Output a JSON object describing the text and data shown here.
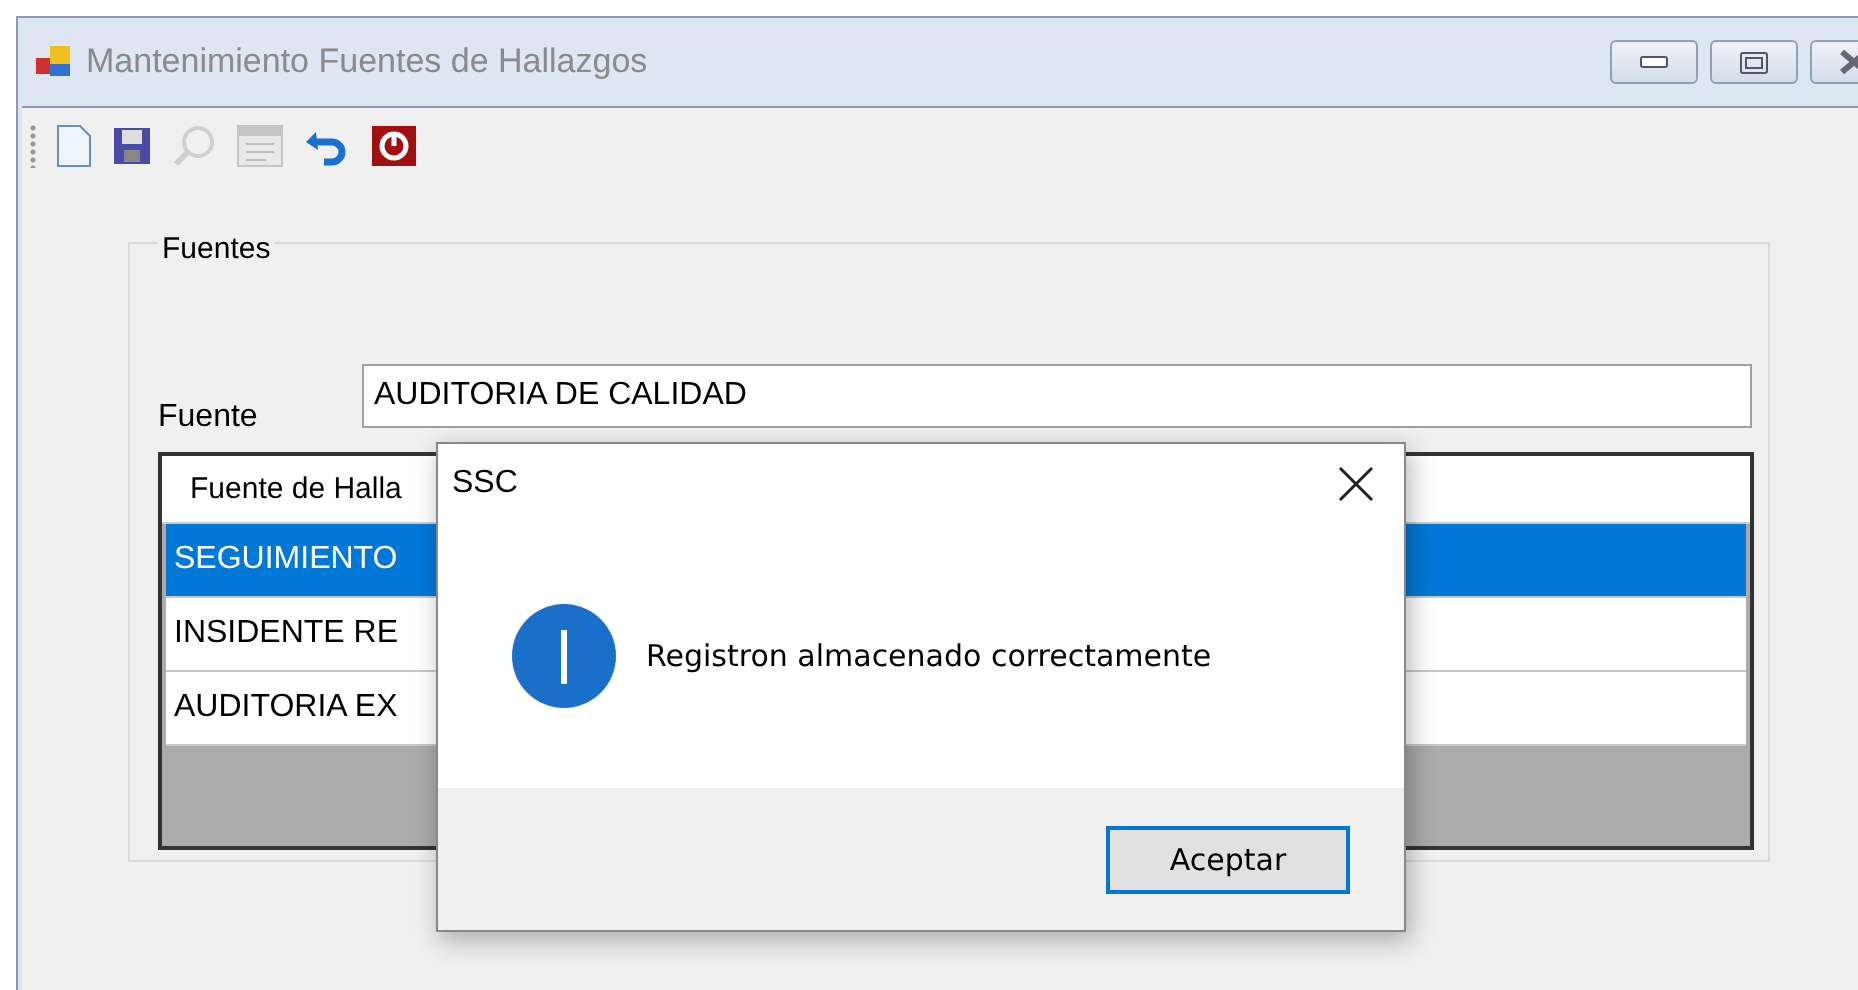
{
  "window": {
    "title": "Mantenimiento Fuentes de Hallazgos",
    "active": false
  },
  "toolbar": [
    {
      "kind": "new",
      "disabled": false
    },
    {
      "kind": "save",
      "disabled": false
    },
    {
      "kind": "search",
      "disabled": true
    },
    {
      "kind": "form",
      "disabled": true
    },
    {
      "kind": "undo",
      "disabled": false
    },
    {
      "kind": "exit",
      "disabled": false
    }
  ],
  "group": {
    "title": "Fuentes",
    "field": {
      "label": "Fuente",
      "value": "AUDITORIA DE CALIDAD"
    },
    "grid": {
      "columns": [
        "Fuente de Halla"
      ],
      "rows": [
        {
          "cells": [
            "SEGUIMIENTO"
          ],
          "selected": true
        },
        {
          "cells": [
            "INSIDENTE RE"
          ],
          "selected": false
        },
        {
          "cells": [
            "AUDITORIA EX"
          ],
          "selected": false
        }
      ]
    }
  },
  "dialog": {
    "title": "SSC",
    "message": "Registron almacenado correctamente",
    "buttons": [
      {
        "label": "Aceptar",
        "default": true
      }
    ]
  }
}
